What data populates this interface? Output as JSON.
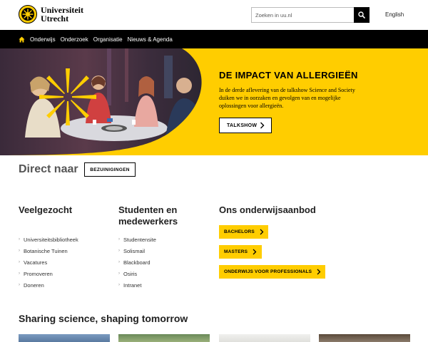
{
  "header": {
    "logo_line1": "Universiteit",
    "logo_line2": "Utrecht",
    "search_placeholder": "Zoeken in uu.nl",
    "language_link": "English"
  },
  "nav": {
    "items": [
      "Onderwijs",
      "Onderzoek",
      "Organisatie",
      "Nieuws & Agenda"
    ]
  },
  "hero": {
    "title": "DE IMPACT VAN ALLERGIEËN",
    "text": "In de derde aflevering van de talkshow Science and Society duiken we in oorzaken en gevolgen van en mogelijke oplossingen voor allergieën.",
    "button_label": "TALKSHOW"
  },
  "direct": {
    "title": "Direct naar",
    "button_label": "BEZUINIGINGEN"
  },
  "columns": {
    "veelgezocht": {
      "title": "Veelgezocht",
      "links": [
        "Universiteitsbibliotheek",
        "Botanische Tuinen",
        "Vacatures",
        "Promoveren",
        "Doneren"
      ]
    },
    "studenten": {
      "title_line1": "Studenten en",
      "title_line2": "medewerkers",
      "links": [
        "Studentensite",
        "Solismail",
        "Blackboard",
        "Osiris",
        "Intranet"
      ]
    },
    "onderwijs": {
      "title": "Ons onderwijsaanbod",
      "buttons": [
        "BACHELORS",
        "MASTERS",
        "ONDERWIJS VOOR PROFESSIONALS"
      ]
    }
  },
  "sharing": {
    "title": "Sharing science, shaping tomorrow"
  },
  "colors": {
    "brand_yellow": "#ffcd00",
    "nav_black": "#000000"
  }
}
